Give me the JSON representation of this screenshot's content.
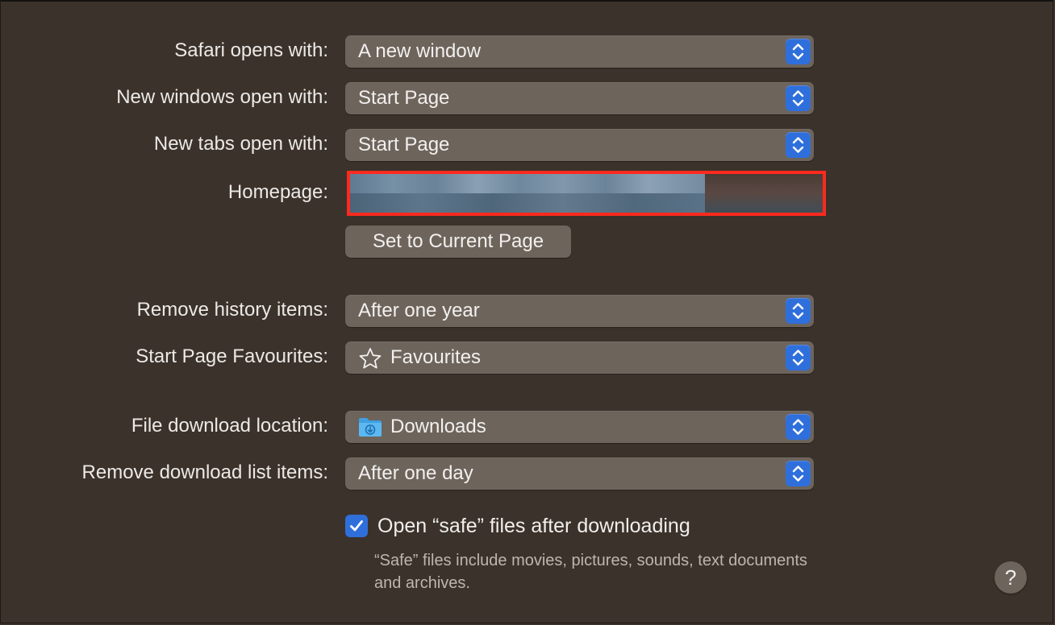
{
  "settings": {
    "safari_opens_with": {
      "label": "Safari opens with:",
      "value": "A new window"
    },
    "new_windows_open_with": {
      "label": "New windows open with:",
      "value": "Start Page"
    },
    "new_tabs_open_with": {
      "label": "New tabs open with:",
      "value": "Start Page"
    },
    "homepage": {
      "label": "Homepage:",
      "value": ""
    },
    "set_current_page": {
      "label": "Set to Current Page"
    },
    "remove_history_items": {
      "label": "Remove history items:",
      "value": "After one year"
    },
    "start_page_favourites": {
      "label": "Start Page Favourites:",
      "value": "Favourites",
      "icon": "star-icon"
    },
    "file_download_location": {
      "label": "File download location:",
      "value": "Downloads",
      "icon": "downloads-folder-icon"
    },
    "remove_download_list_items": {
      "label": "Remove download list items:",
      "value": "After one day"
    },
    "open_safe_files": {
      "label": "Open “safe” files after downloading",
      "checked": true,
      "hint": "“Safe” files include movies, pictures, sounds, text documents and archives."
    },
    "help": {
      "label": "?"
    }
  },
  "colors": {
    "background": "#3b322b",
    "control": "#6d645c",
    "accent": "#2f6fdc",
    "highlight_border": "#ff2a1e"
  }
}
